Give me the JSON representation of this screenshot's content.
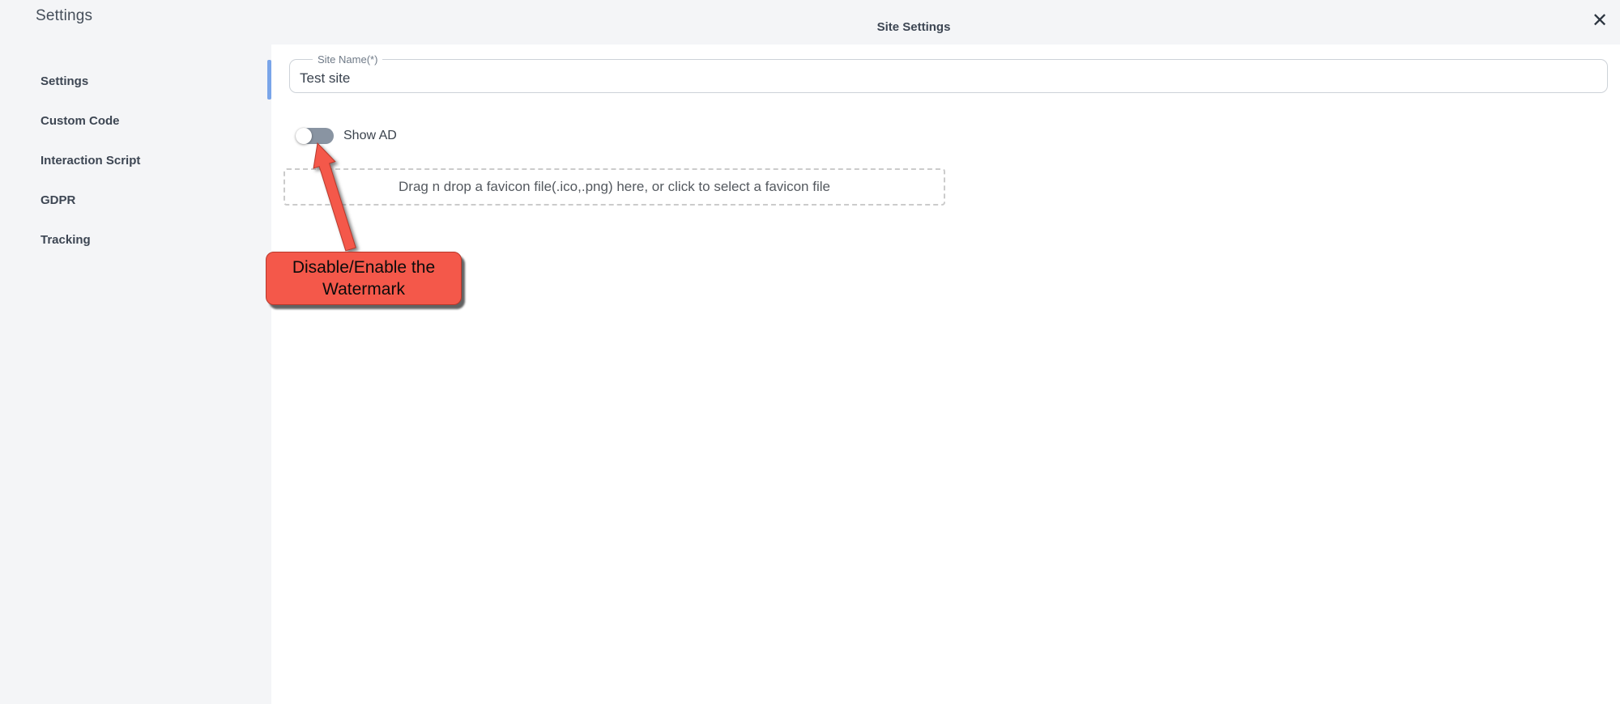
{
  "window": {
    "title": "Settings"
  },
  "dialog": {
    "title": "Site Settings",
    "close_icon": "✕"
  },
  "sidebar": {
    "items": [
      {
        "label": "Settings",
        "active": true
      },
      {
        "label": "Custom Code",
        "active": false
      },
      {
        "label": "Interaction Script",
        "active": false
      },
      {
        "label": "GDPR",
        "active": false
      },
      {
        "label": "Tracking",
        "active": false
      }
    ],
    "active_indicator_color": "#7aa5e9"
  },
  "form": {
    "site_name": {
      "label": "Site Name(*)",
      "value": "Test site"
    },
    "show_ad": {
      "label": "Show AD",
      "enabled": false,
      "track_color": "#8994a2"
    },
    "favicon_dropzone": {
      "text": "Drag n drop a favicon file(.ico,.png) here, or click to select a favicon file"
    }
  },
  "annotation": {
    "lines": [
      "Disable/Enable the",
      "Watermark"
    ],
    "color": "#f4584a",
    "points_to": "show-ad-toggle"
  },
  "colors": {
    "page_background": "#f4f5f7",
    "panel_background": "#ffffff",
    "text_dark": "#3d4653",
    "label_gray": "#6f7a87",
    "input_border": "#cdd2d8",
    "annotation_red": "#f4584a"
  }
}
